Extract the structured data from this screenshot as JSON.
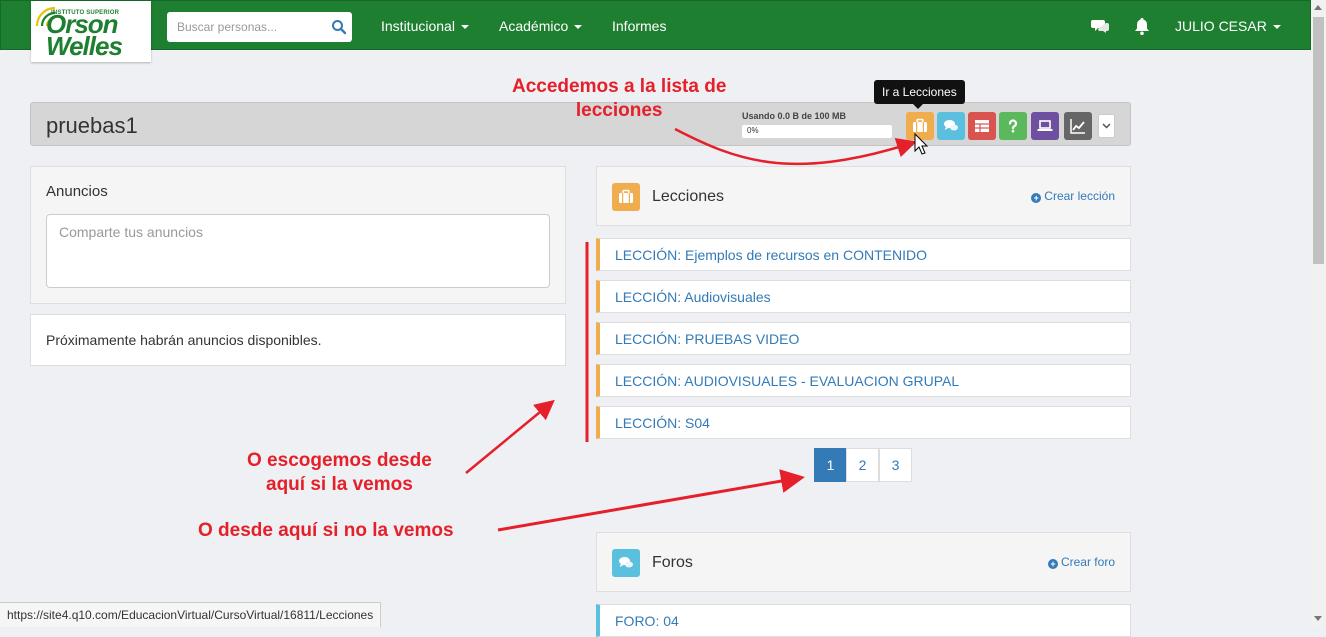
{
  "navbar": {
    "logo_top": "INSTITUTO SUPERIOR",
    "logo_line1": "Orson",
    "logo_line2": "Welles",
    "search_placeholder": "Buscar personas...",
    "menu": [
      "Institucional",
      "Académico",
      "Informes"
    ],
    "user": "JULIO CESAR",
    "icons": [
      "chat-icon",
      "bell-icon"
    ]
  },
  "course": {
    "title": "pruebas1",
    "usage_label": "Usando 0.0 B de 100 MB",
    "usage_pct_text": "0%",
    "usage_fraction": 0,
    "toolbar_tooltip": "Ir a Lecciones",
    "toolbar": [
      {
        "icon": "briefcase-icon",
        "color": "#f0ad4e"
      },
      {
        "icon": "comments-icon",
        "color": "#5bc0de"
      },
      {
        "icon": "table-icon",
        "color": "#d9534f"
      },
      {
        "icon": "question-icon",
        "color": "#5cb85c"
      },
      {
        "icon": "laptop-icon",
        "color": "#6f4fa0"
      },
      {
        "icon": "chart-line-icon",
        "color": "#666666"
      }
    ]
  },
  "announcements": {
    "title": "Anuncios",
    "placeholder": "Comparte tus anuncios",
    "empty_message": "Próximamente habrán anuncios disponibles."
  },
  "lessons": {
    "title": "Lecciones",
    "create_label": "Crear lección",
    "items": [
      "LECCIÓN: Ejemplos de recursos en CONTENIDO",
      "LECCIÓN: Audiovisuales",
      "LECCIÓN: PRUEBAS VIDEO",
      "LECCIÓN: AUDIOVISUALES - EVALUACION GRUPAL",
      "LECCIÓN: S04"
    ],
    "pages": [
      "1",
      "2",
      "3"
    ],
    "active_page": "1"
  },
  "forums": {
    "title": "Foros",
    "create_label": "Crear foro",
    "items": [
      "FORO: 04"
    ]
  },
  "annotations": {
    "access_line1": "Accedemos a la lista de",
    "access_line2": "lecciones",
    "choose_line1": "O escogemos desde",
    "choose_line2": "aquí si la vemos",
    "pager_note": "O desde aquí si no la vemos"
  },
  "statusbar_url": "https://site4.q10.com/EducacionVirtual/CursoVirtual/16811/Lecciones",
  "colors": {
    "navbar": "#1e7f30",
    "link": "#337ab7",
    "lesson_accent": "#f0ad4e",
    "forum_accent": "#5bc0de",
    "annotation": "#e5202a"
  }
}
